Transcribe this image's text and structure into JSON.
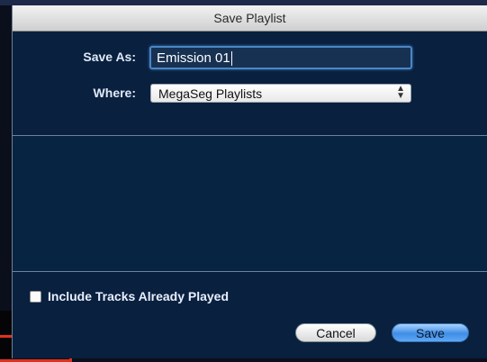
{
  "dialog": {
    "title": "Save Playlist",
    "save_as_label": "Save As:",
    "save_as_value": "Emission 01",
    "where_label": "Where:",
    "where_value": "MegaSeg Playlists",
    "include_played_label": "Include Tracks Already Played",
    "include_played_checked": false,
    "cancel_label": "Cancel",
    "save_label": "Save"
  },
  "icons": {
    "popup_arrows": "up-down-chevron-icon"
  },
  "colors": {
    "sheet_background": "#09203f",
    "default_button": "#3f8de6",
    "focus_ring": "#4b86c4"
  }
}
